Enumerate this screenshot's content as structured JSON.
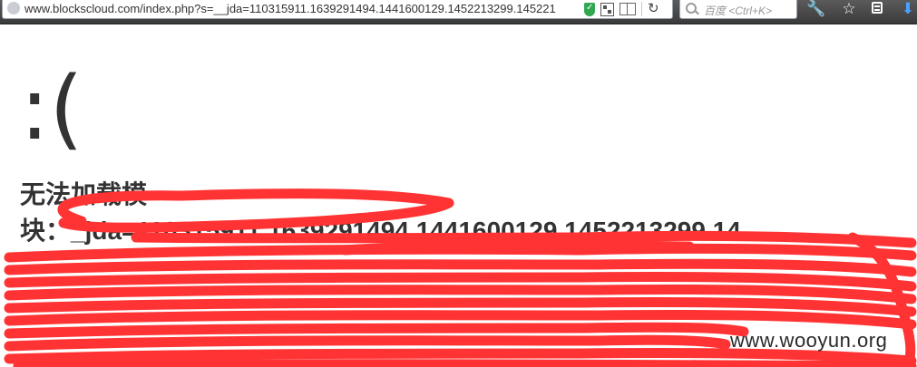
{
  "browser": {
    "url": "www.blockscloud.com/index.php?s=__jda=110315911.1639291494.1441600129.1452213299.145221",
    "search_placeholder": "百度 <Ctrl+K>",
    "icons": [
      "globe-icon",
      "shield-icon",
      "qr-icon",
      "reader-icon",
      "refresh-icon",
      "search-icon",
      "wrench-icon",
      "star-icon",
      "menu-icon",
      "download-icon"
    ]
  },
  "page": {
    "face": ":(",
    "title": "无法加载模",
    "detail_lines": [
      "块：_jda=110315911.1639291494.1441600129.1452213299.14"
    ]
  },
  "redaction_color": "#ff3333",
  "watermark": "www.wooyun.org"
}
